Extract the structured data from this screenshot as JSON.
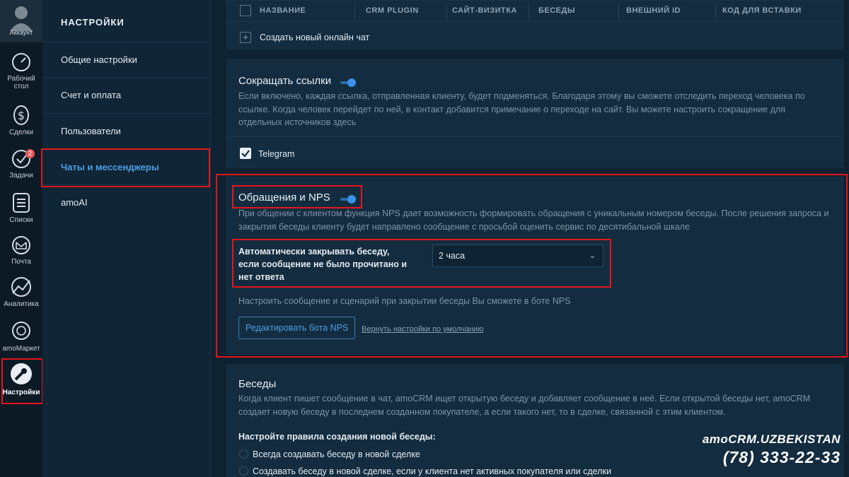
{
  "rail": {
    "items": [
      {
        "label": "Аккаунт",
        "icon": "avatar-icon"
      },
      {
        "label": "Рабочий стол",
        "icon": "dashboard-icon"
      },
      {
        "label": "Сделки",
        "icon": "dollar-icon"
      },
      {
        "label": "Задачи",
        "icon": "check-circle-icon",
        "badge": "2"
      },
      {
        "label": "Списки",
        "icon": "list-icon"
      },
      {
        "label": "Почта",
        "icon": "mail-icon"
      },
      {
        "label": "Аналитика",
        "icon": "analytics-icon"
      },
      {
        "label": "amoМаркет",
        "icon": "market-icon"
      },
      {
        "label": "Настройки",
        "icon": "wrench-icon"
      }
    ]
  },
  "menu": {
    "title": "НАСТРОЙКИ",
    "items": [
      {
        "label": "Общие настройки"
      },
      {
        "label": "Счет и оплата"
      },
      {
        "label": "Пользователи"
      },
      {
        "label": "Чаты и мессенджеры"
      },
      {
        "label": "amoAI"
      }
    ]
  },
  "table": {
    "columns": [
      "НАЗВАНИЕ",
      "CRM PLUGIN",
      "САЙТ-ВИЗИТКА",
      "БЕСЕДЫ",
      "ВНЕШНИЙ ID",
      "КОД ДЛЯ ВСТАВКИ"
    ],
    "create_label": "Создать новый онлайн чат"
  },
  "shorten": {
    "title": "Сокращать ссылки",
    "description": "Если включено, каждая ссылка, отправленная клиенту, будет подменяться. Благодаря этому вы сможете отследить переход человека по ссылке. Когда человек перейдет по ней, в контакт добавится примечание о переходе на сайт. Вы можете настроить сокращение для отдельных источников здесь",
    "source_label": "Telegram"
  },
  "nps": {
    "title": "Обращения и NPS",
    "description": "При общении с клиентом функция NPS дает возможность формировать обращения с уникальным номером беседы. После решения запроса и закрытия беседы клиенту будет направлено сообщение с просьбой оценить сервис по десятибальной шкале",
    "autoclose_label": "Автоматически закрывать беседу, если сообщение не было прочитано и нет ответа",
    "autoclose_value": "2 часа",
    "hint": "Настроить сообщение и сценарий при закрытии беседы Вы сможете в боте NPS",
    "edit_button": "Редактировать бота NPS",
    "reset_link": "Вернуть настройки по умолчанию"
  },
  "talks": {
    "title": "Беседы",
    "description": "Когда клиент пишет сообщение в чат, amoCRM ищет открытую беседу и добавляет сообщение в неё. Если открытой беседы нет, amoCRM создает новую беседу в последнем созданном покупателе, а если такого нет, то в сделке, связанной с этим клиентом.",
    "rules_title": "Настройте правила создания новой беседы:",
    "options": [
      "Всегда создавать беседу в новой сделке",
      "Создавать беседу в новой сделке, если у клиента нет активных покупателя или сделки"
    ]
  },
  "brand": {
    "line1": "amoCRM.UZBEKISTAN",
    "phone": "(78) 333-22-33"
  },
  "colors": {
    "accent": "#3a92e8",
    "highlight": "#e3161b",
    "background": "#0f2231"
  }
}
